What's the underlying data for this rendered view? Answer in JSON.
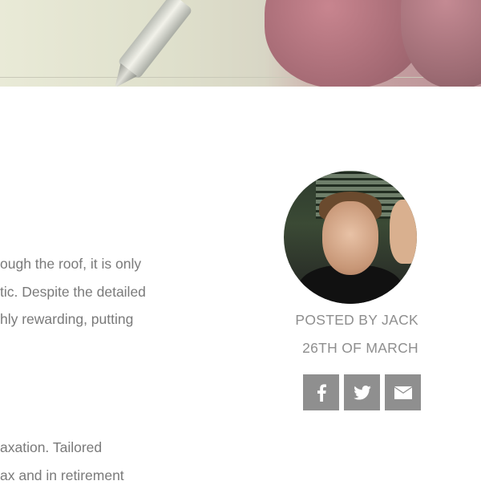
{
  "hero": {
    "image": "pen-and-hand-photo"
  },
  "article": {
    "paragraph1": [
      "ough the roof, it is only",
      "tic. Despite the detailed",
      "hly rewarding, putting"
    ],
    "paragraph2": [
      "axation. Tailored",
      "ax and in retirement"
    ]
  },
  "author": {
    "posted_by": "POSTED BY JACK",
    "date": "26TH OF MARCH",
    "avatar": "author-photo"
  },
  "share": [
    {
      "name": "facebook",
      "icon": "facebook-icon"
    },
    {
      "name": "twitter",
      "icon": "twitter-icon"
    },
    {
      "name": "email",
      "icon": "mail-icon"
    }
  ],
  "colors": {
    "text": "#7a7a7a",
    "meta_text": "#8e8e8e",
    "share_button_bg": "#8f8f8f"
  }
}
